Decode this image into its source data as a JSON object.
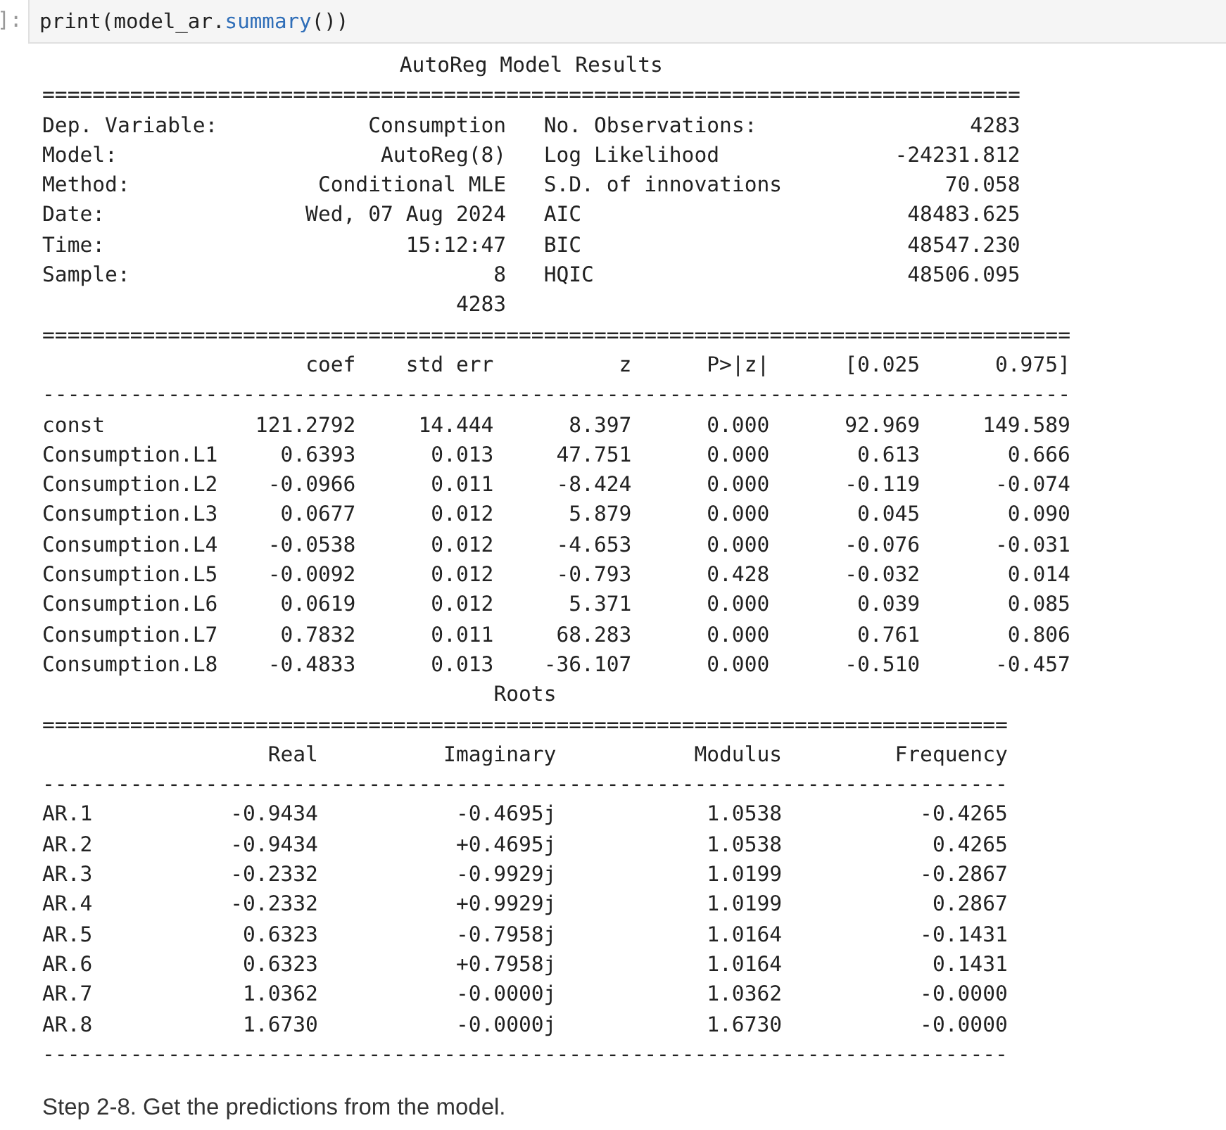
{
  "input_cell": {
    "prompt": "]:",
    "code": [
      {
        "text": "print(model_ar.",
        "kind": "plain"
      },
      {
        "text": "summary",
        "kind": "attr"
      },
      {
        "text": "())",
        "kind": "plain"
      }
    ]
  },
  "output": {
    "title": "AutoReg Model Results",
    "model_table": {
      "rule_top": "==============================================================================",
      "rows": [
        {
          "label": "Dep. Variable:",
          "value": "Consumption",
          "label_2": "No. Observations:",
          "value_2": "4283"
        },
        {
          "label": "Model:",
          "value": "AutoReg(8)",
          "label_2": "Log Likelihood",
          "value_2": "-24231.812"
        },
        {
          "label": "Method:",
          "value": "Conditional MLE",
          "label_2": "S.D. of innovations",
          "value_2": "70.058"
        },
        {
          "label": "Date:",
          "value": "Wed, 07 Aug 2024",
          "label_2": "AIC",
          "value_2": "48483.625"
        },
        {
          "label": "Time:",
          "value": "15:12:47",
          "label_2": "BIC",
          "value_2": "48547.230"
        },
        {
          "label": "Sample:",
          "value": "8",
          "label_2": "HQIC",
          "value_2": "48506.095"
        }
      ],
      "sample_end": "4283"
    },
    "coef_table": {
      "rule_top": "==================================================================================",
      "columns": [
        "",
        "coef",
        "std err",
        "z",
        "P>|z|",
        "[0.025",
        "0.975]"
      ],
      "rule_mid": "----------------------------------------------------------------------------------",
      "rows": [
        [
          "const",
          "121.2792",
          "14.444",
          "8.397",
          "0.000",
          "92.969",
          "149.589"
        ],
        [
          "Consumption.L1",
          "0.6393",
          "0.013",
          "47.751",
          "0.000",
          "0.613",
          "0.666"
        ],
        [
          "Consumption.L2",
          "-0.0966",
          "0.011",
          "-8.424",
          "0.000",
          "-0.119",
          "-0.074"
        ],
        [
          "Consumption.L3",
          "0.0677",
          "0.012",
          "5.879",
          "0.000",
          "0.045",
          "0.090"
        ],
        [
          "Consumption.L4",
          "-0.0538",
          "0.012",
          "-4.653",
          "0.000",
          "-0.076",
          "-0.031"
        ],
        [
          "Consumption.L5",
          "-0.0092",
          "0.012",
          "-0.793",
          "0.428",
          "-0.032",
          "0.014"
        ],
        [
          "Consumption.L6",
          "0.0619",
          "0.012",
          "5.371",
          "0.000",
          "0.039",
          "0.085"
        ],
        [
          "Consumption.L7",
          "0.7832",
          "0.011",
          "68.283",
          "0.000",
          "0.761",
          "0.806"
        ],
        [
          "Consumption.L8",
          "-0.4833",
          "0.013",
          "-36.107",
          "0.000",
          "-0.510",
          "-0.457"
        ]
      ]
    },
    "roots_table": {
      "title": "Roots",
      "rule_top": "=============================================================================",
      "columns": [
        "",
        "Real",
        "Imaginary",
        "Modulus",
        "Frequency"
      ],
      "rule_mid": "-----------------------------------------------------------------------------",
      "rows": [
        [
          "AR.1",
          "-0.9434",
          "-0.4695j",
          "1.0538",
          "-0.4265"
        ],
        [
          "AR.2",
          "-0.9434",
          "+0.4695j",
          "1.0538",
          "0.4265"
        ],
        [
          "AR.3",
          "-0.2332",
          "-0.9929j",
          "1.0199",
          "-0.2867"
        ],
        [
          "AR.4",
          "-0.2332",
          "+0.9929j",
          "1.0199",
          "0.2867"
        ],
        [
          "AR.5",
          "0.6323",
          "-0.7958j",
          "1.0164",
          "-0.1431"
        ],
        [
          "AR.6",
          "0.6323",
          "+0.7958j",
          "1.0164",
          "0.1431"
        ],
        [
          "AR.7",
          "1.0362",
          "-0.0000j",
          "1.0362",
          "-0.0000"
        ],
        [
          "AR.8",
          "1.6730",
          "-0.0000j",
          "1.6730",
          "-0.0000"
        ]
      ],
      "rule_bottom": "-----------------------------------------------------------------------------"
    }
  },
  "step_text": "Step 2-8. Get the predictions from the model."
}
